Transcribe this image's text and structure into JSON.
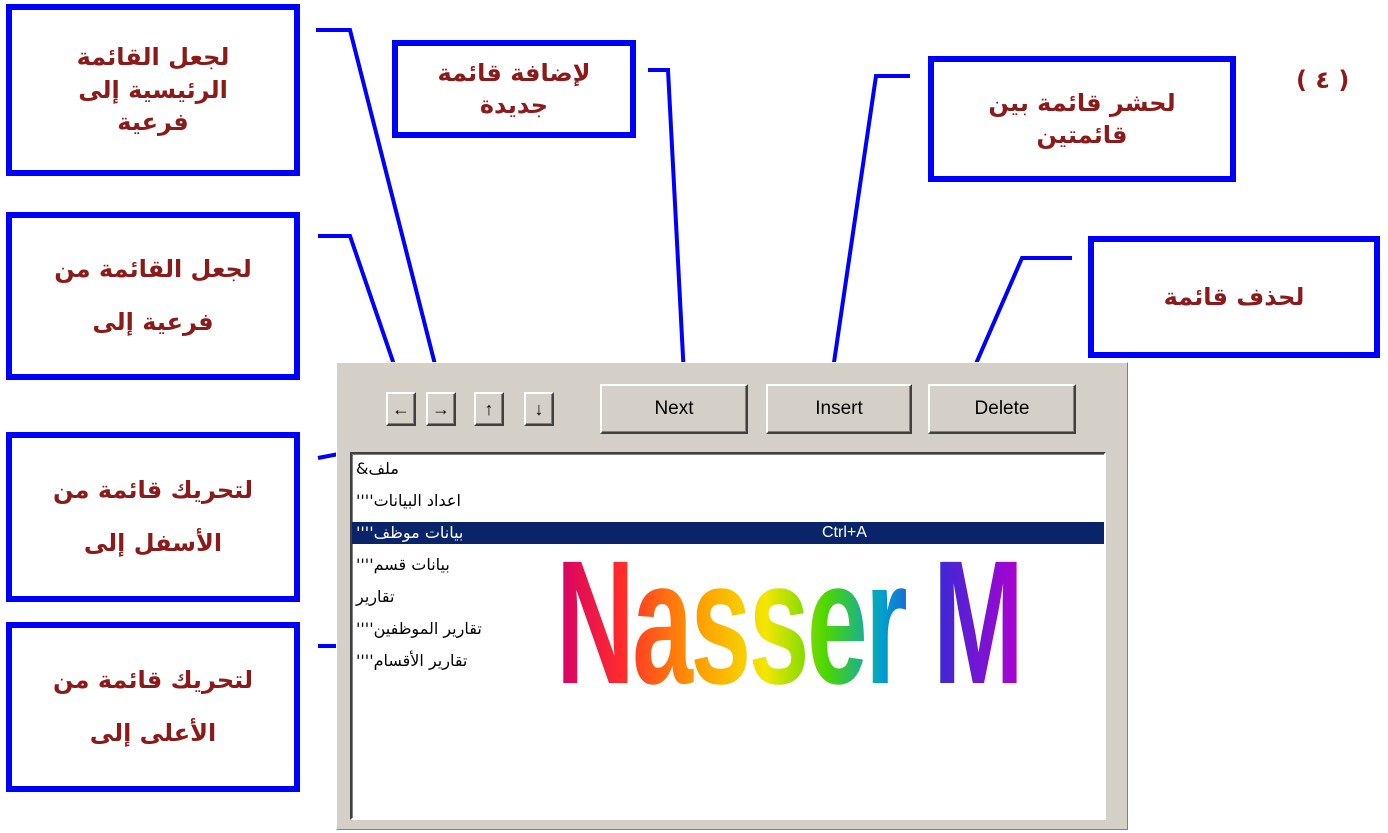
{
  "step_label": "( ٤ )",
  "callouts": {
    "main_to_sub": [
      "لجعل القائمة",
      "الرئيسية إلى",
      "فرعية"
    ],
    "add_new": [
      "لإضافة قائمة",
      "جديدة"
    ],
    "insert_between": [
      "لحشر قائمة بين",
      "قائمتين"
    ],
    "delete_menu": [
      "لحذف قائمة"
    ],
    "sub_to": [
      "لجعل القائمة من",
      "فرعية إلى"
    ],
    "move_bottom_up": [
      "لتحريك قائمة من",
      "الأسفل إلى"
    ],
    "move_top_down": [
      "لتحريك قائمة من",
      "الأعلى إلى"
    ]
  },
  "toolbar": {
    "left_arrow": "←",
    "right_arrow": "→",
    "up_arrow": "↑",
    "down_arrow": "↓",
    "next_label": "Next",
    "insert_label": "Insert",
    "delete_label": "Delete"
  },
  "menu_list": [
    {
      "text": "ملف&",
      "shortcut": "",
      "selected": false
    },
    {
      "text": "اعداد البيانات''''",
      "shortcut": "",
      "selected": false
    },
    {
      "text": "بيانات موظف''''",
      "shortcut": "Ctrl+A",
      "selected": true
    },
    {
      "text": "بيانات قسم''''",
      "shortcut": "",
      "selected": false
    },
    {
      "text": "تقارير",
      "shortcut": "",
      "selected": false
    },
    {
      "text": "تقارير الموظفين''''",
      "shortcut": "",
      "selected": false
    },
    {
      "text": "تقارير الأقسام''''",
      "shortcut": "",
      "selected": false
    }
  ],
  "watermark": "Nasser M",
  "colors": {
    "callout_border": "#0000ff",
    "callout_text": "#8b1a1a",
    "selection": "#0a246a"
  }
}
